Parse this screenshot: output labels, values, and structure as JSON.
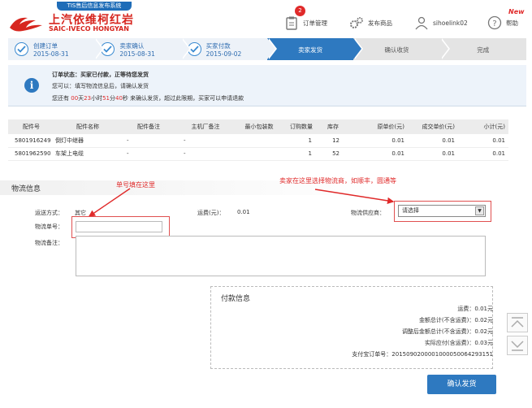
{
  "header": {
    "badge_title": "TIS售后信息发布系统",
    "logo_cn": "上汽依维柯红岩",
    "logo_en": "SAIC-IVECO HONGYAN",
    "nav": [
      {
        "label": "订单管理",
        "icon": "clipboard-icon",
        "count": "2"
      },
      {
        "label": "发布商品",
        "icon": "gears-icon"
      },
      {
        "label": "sihoelink02",
        "icon": "user-icon"
      },
      {
        "label": "帮助",
        "icon": "help-icon",
        "tag": "New"
      }
    ]
  },
  "steps": [
    {
      "title": "创建订单",
      "date": "2015-08-31",
      "state": "done"
    },
    {
      "title": "卖家确认",
      "date": "2015-08-31",
      "state": "done"
    },
    {
      "title": "买家付款",
      "date": "2015-09-02",
      "state": "done"
    },
    {
      "title": "卖家发货",
      "state": "current"
    },
    {
      "title": "确认收货",
      "state": "todo"
    },
    {
      "title": "完成",
      "state": "todo"
    }
  ],
  "status": {
    "line1": "订单状态：买家已付款，正等待您发货",
    "line2": "您可以：填写物流信息后，请确认发货",
    "line3_pre": "您还有",
    "days": "00",
    "days_unit": "天",
    "hours": "23",
    "hours_unit": "小时",
    "mins": "51",
    "mins_unit": "分",
    "secs": "40",
    "secs_unit": "秒",
    "line3_post": "来确认发货，超过此限期，买家可以申请退款"
  },
  "table": {
    "headers": [
      "配件号",
      "配件名称",
      "配件备注",
      "主机厂备注",
      "最小包装数",
      "订购数量",
      "库存",
      "原单价(元)",
      "成交单价(元)",
      "小计(元)"
    ],
    "rows": [
      [
        "5801916249",
        "倒灯中继器",
        "-",
        "-",
        "",
        "1",
        "12",
        "0.01",
        "0.01",
        "0.01"
      ],
      [
        "5801962590",
        "车架上电缆",
        "-",
        "-",
        "",
        "1",
        "52",
        "0.01",
        "0.01",
        "0.01"
      ]
    ]
  },
  "logistics": {
    "title": "物流信息",
    "annotation_tracking": "单号填在这里",
    "annotation_supplier": "卖家在这里选择物流商，如顺丰，圆通等",
    "shipping_method_label": "运送方式：",
    "shipping_method_value": "其它",
    "freight_label": "运费(元)：",
    "freight_value": "0.01",
    "supplier_label": "物流供应商：",
    "supplier_value": "请选择",
    "tracking_label": "物流单号：",
    "remarks_label": "物流备注："
  },
  "payment": {
    "title": "付款信息",
    "rows": [
      {
        "label": "运费：",
        "value": "0.01元"
      },
      {
        "label": "金额总计(不含运费)：",
        "value": "0.02元"
      },
      {
        "label": "调整后金额总计(不含运费)：",
        "value": "0.02元"
      },
      {
        "label": "实际应付(含运费)：",
        "value": "0.03元"
      },
      {
        "label": "支付宝订单号：",
        "value": "2015090200001000050064293151"
      }
    ]
  },
  "confirm_button": "确认发货",
  "colors": {
    "accent": "#2e79c0",
    "brand_red": "#d7261f",
    "alert_red": "#e02a2a"
  }
}
